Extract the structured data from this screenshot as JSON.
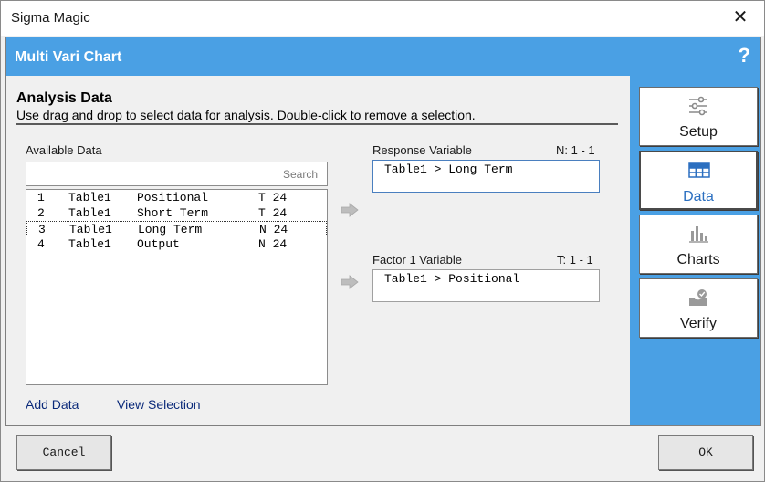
{
  "window": {
    "title": "Sigma Magic",
    "close_glyph": "✕"
  },
  "header": {
    "title": "Multi Vari Chart",
    "help_glyph": "?"
  },
  "section": {
    "title": "Analysis Data",
    "description": "Use drag and drop to select data for analysis. Double-click to remove a selection."
  },
  "available": {
    "label": "Available Data",
    "search_placeholder": "Search",
    "rows": [
      {
        "num": "1",
        "table": "Table1",
        "name": "Positional",
        "type": "T 24"
      },
      {
        "num": "2",
        "table": "Table1",
        "name": "Short Term",
        "type": "T 24"
      },
      {
        "num": "3",
        "table": "Table1",
        "name": "Long Term",
        "type": "N 24"
      },
      {
        "num": "4",
        "table": "Table1",
        "name": "Output",
        "type": "N 24"
      }
    ],
    "add_link": "Add Data",
    "view_link": "View Selection"
  },
  "response": {
    "label": "Response Variable",
    "count": "N: 1 - 1",
    "value": "Table1 > Long Term"
  },
  "factor": {
    "label": "Factor 1 Variable",
    "count": "T: 1 - 1",
    "value": "Table1 > Positional"
  },
  "nav": [
    {
      "label": "Setup",
      "icon": "sliders-icon"
    },
    {
      "label": "Data",
      "icon": "table-grid-icon",
      "active": true
    },
    {
      "label": "Charts",
      "icon": "bar-chart-icon"
    },
    {
      "label": "Verify",
      "icon": "verify-check-icon"
    }
  ],
  "footer": {
    "cancel_label": "Cancel",
    "ok_label": "OK"
  },
  "colors": {
    "accent": "#4aa0e4",
    "active_nav": "#2b6fc0",
    "link": "#0b2a7a"
  }
}
